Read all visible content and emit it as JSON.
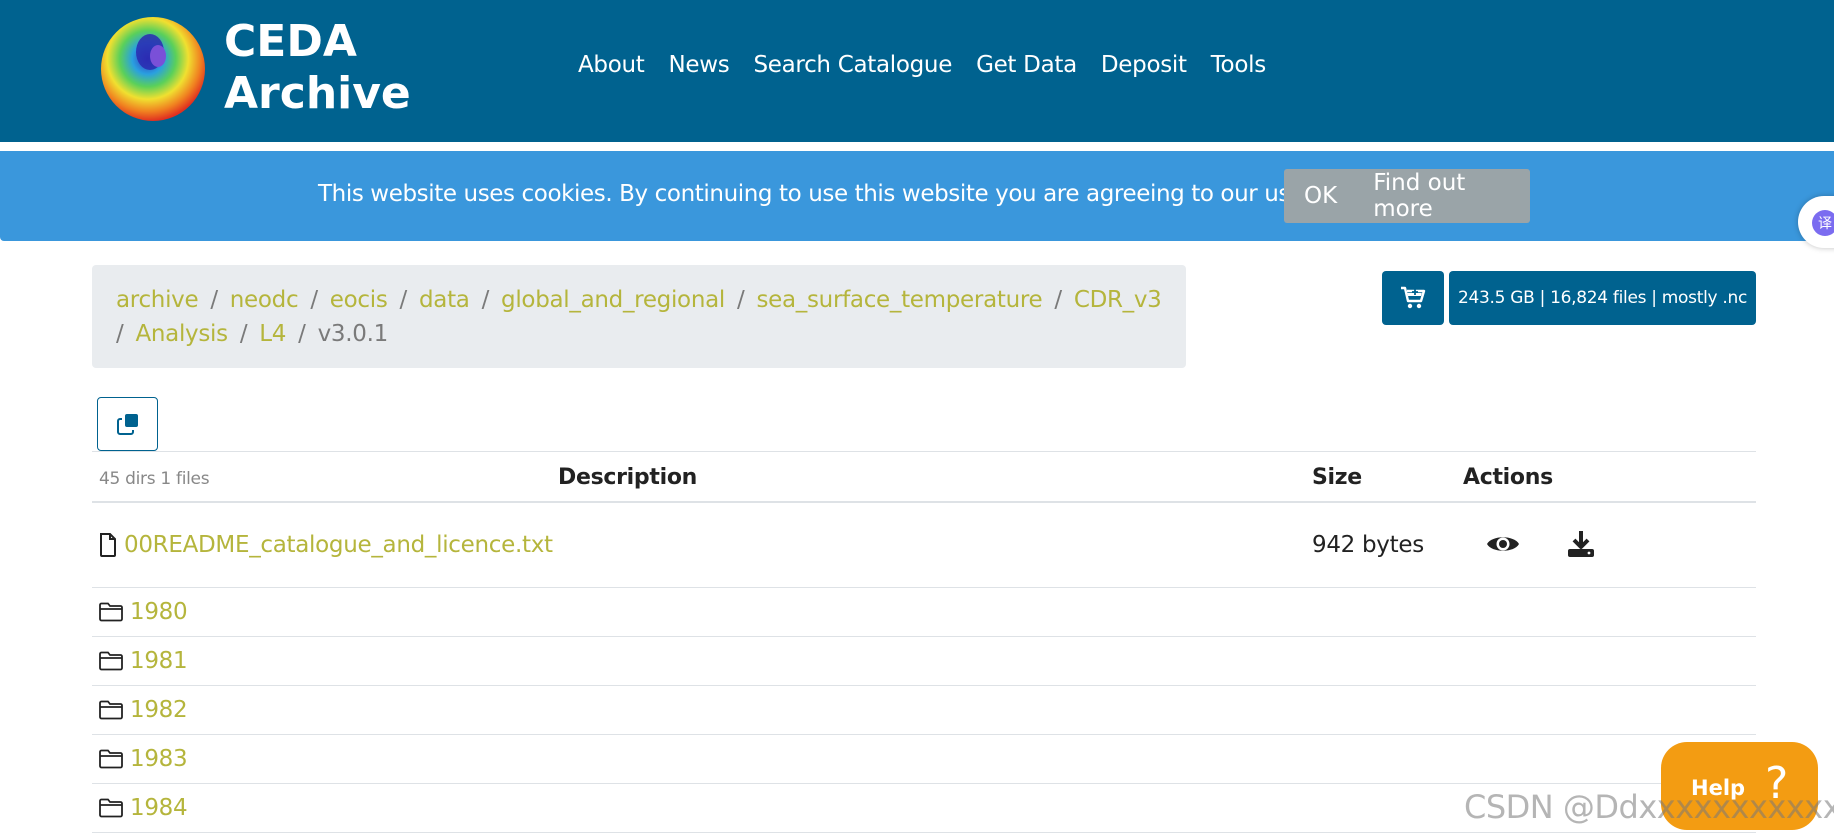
{
  "logo": {
    "line1": "CEDA",
    "line2": "Archive",
    "icon": "globe-logo-icon"
  },
  "nav": [
    "About",
    "News",
    "Search Catalogue",
    "Get Data",
    "Deposit",
    "Tools"
  ],
  "cookie": {
    "text": "This website uses cookies. By continuing to use this website you are agreeing to our use of cookies.",
    "ok": "OK",
    "more": "Find out more"
  },
  "breadcrumb": {
    "items": [
      "archive",
      "neodc",
      "eocis",
      "data",
      "global_and_regional",
      "sea_surface_temperature",
      "CDR_v3",
      "Analysis",
      "L4"
    ],
    "current": "v3.0.1",
    "separator": "/"
  },
  "cart": {
    "icon": "cart-icon"
  },
  "info": "243.5 GB | 16,824 files | mostly .nc",
  "copy": {
    "icon": "copy-icon"
  },
  "table": {
    "count": "45 dirs 1 files",
    "headers": {
      "description": "Description",
      "size": "Size",
      "actions": "Actions"
    },
    "file": {
      "name": "00README_catalogue_and_licence.txt",
      "size": "942 bytes",
      "icon": "file-icon"
    },
    "dirs": [
      "1980",
      "1981",
      "1982",
      "1983",
      "1984"
    ]
  },
  "help": {
    "label": "Help",
    "glyph": "?"
  },
  "watermark": "CSDN @Ddxxxxxxxxxxxx",
  "colors": {
    "header": "#00628f",
    "cookie": "#3a97dc",
    "link": "#b5b53c",
    "help": "#f39c12"
  }
}
